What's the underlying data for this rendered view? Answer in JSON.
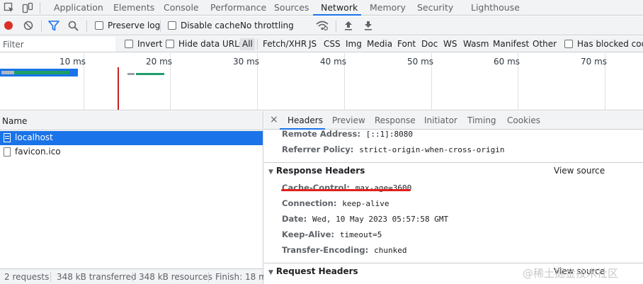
{
  "top_tabs": [
    "Application",
    "Elements",
    "Console",
    "Performance",
    "Sources",
    "Network",
    "Memory",
    "Security",
    "Lighthouse"
  ],
  "active_tab": "Network",
  "toolbar": {
    "preserve_log": "Preserve log",
    "disable_cache": "Disable cache",
    "throttling": "No throttling"
  },
  "filter": {
    "placeholder": "Filter",
    "invert": "Invert",
    "hide_data_urls": "Hide data URLs",
    "types": [
      "All",
      "Fetch/XHR",
      "JS",
      "CSS",
      "Img",
      "Media",
      "Font",
      "Doc",
      "WS",
      "Wasm",
      "Manifest",
      "Other"
    ],
    "has_blocked": "Has blocked cook"
  },
  "overview": {
    "ticks": [
      "10 ms",
      "20 ms",
      "30 ms",
      "40 ms",
      "50 ms",
      "60 ms",
      "70 ms"
    ]
  },
  "request_list": {
    "header": "Name",
    "rows": [
      "localhost",
      "favicon.ico"
    ],
    "selected": "localhost"
  },
  "status_bar": {
    "requests": "2 requests",
    "transferred": "348 kB transferred",
    "resources": "348 kB resources",
    "finish": "Finish: 18 m"
  },
  "details": {
    "close": "×",
    "tabs": [
      "Headers",
      "Preview",
      "Response",
      "Initiator",
      "Timing",
      "Cookies"
    ],
    "active_tab": "Headers",
    "general": [
      {
        "key": "Remote Address:",
        "value": "[::1]:8080"
      },
      {
        "key": "Referrer Policy:",
        "value": "strict-origin-when-cross-origin"
      }
    ],
    "response_headers_title": "Response Headers",
    "view_source": "View source",
    "response_headers": [
      {
        "key": "Cache-Control:",
        "value": "max-age=3600"
      },
      {
        "key": "Connection:",
        "value": "keep-alive"
      },
      {
        "key": "Date:",
        "value": "Wed, 10 May 2023 05:57:58 GMT"
      },
      {
        "key": "Keep-Alive:",
        "value": "timeout=5"
      },
      {
        "key": "Transfer-Encoding:",
        "value": "chunked"
      }
    ],
    "request_headers_title": "Request Headers"
  },
  "watermark": "@稀土掘金技术社区",
  "colors": {
    "accent": "#1a73e8",
    "record": "#d93025",
    "selected_row": "#1a73e8",
    "annotation": "#e0201b"
  }
}
